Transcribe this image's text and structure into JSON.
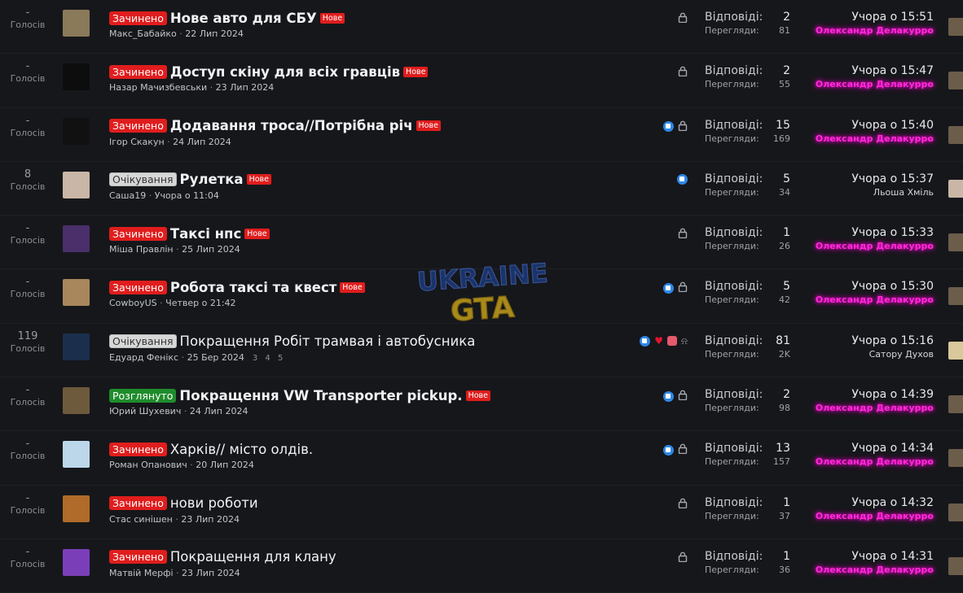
{
  "labels": {
    "votes": "Голосів",
    "replies": "Відповіді:",
    "views": "Перегляди:",
    "new": "Нове",
    "sep": " · "
  },
  "watermark": {
    "line1": "UKRAINE",
    "line2": "GTA"
  },
  "threads": [
    {
      "votes": "-",
      "prefix": "Зачинено",
      "prefix_type": "closed",
      "title": "Нове авто для СБУ",
      "bold": true,
      "is_new": true,
      "author": "Макс_Бабайко",
      "date": "22 Лип 2024",
      "icons": [
        "lock-icon"
      ],
      "replies": "2",
      "views": "81",
      "last_date": "Учора о 15:51",
      "last_user": "Олександр Делакурро",
      "last_user_style": "special",
      "avatar_color": "#8a7a5a",
      "last_av_color": "#6b5d4a"
    },
    {
      "votes": "-",
      "prefix": "Зачинено",
      "prefix_type": "closed",
      "title": "Доступ скіну для всіх гравців",
      "bold": true,
      "is_new": true,
      "author": "Назар Мачизбевськи",
      "date": "23 Лип 2024",
      "icons": [
        "lock-icon"
      ],
      "replies": "2",
      "views": "55",
      "last_date": "Учора о 15:47",
      "last_user": "Олександр Делакурро",
      "last_user_style": "special",
      "avatar_color": "#0d0d0d",
      "last_av_color": "#6b5d4a"
    },
    {
      "votes": "-",
      "prefix": "Зачинено",
      "prefix_type": "closed",
      "title": "Додавання троса//Потрібна річ",
      "bold": true,
      "is_new": true,
      "author": "Ігор Скакун",
      "date": "24 Лип 2024",
      "icons": [
        "like-icon",
        "lock-icon"
      ],
      "replies": "15",
      "views": "169",
      "last_date": "Учора о 15:40",
      "last_user": "Олександр Делакурро",
      "last_user_style": "special",
      "avatar_color": "#111111",
      "last_av_color": "#6b5d4a"
    },
    {
      "votes": "8",
      "prefix": "Очікування",
      "prefix_type": "pending",
      "title": "Рулетка",
      "bold": true,
      "is_new": true,
      "author": "Саша19",
      "date": "Учора о 11:04",
      "icons": [
        "like-icon"
      ],
      "replies": "5",
      "views": "34",
      "last_date": "Учора о 15:37",
      "last_user": "Льоша Хміль",
      "last_user_style": "plain",
      "avatar_color": "#c9b6a6",
      "last_av_color": "#c9b6a6"
    },
    {
      "votes": "-",
      "prefix": "Зачинено",
      "prefix_type": "closed",
      "title": "Таксі нпс",
      "bold": true,
      "is_new": true,
      "author": "Міша Правлін",
      "date": "25 Лип 2024",
      "icons": [
        "lock-icon"
      ],
      "replies": "1",
      "views": "26",
      "last_date": "Учора о 15:33",
      "last_user": "Олександр Делакурро",
      "last_user_style": "special",
      "avatar_color": "#4a2f6b",
      "last_av_color": "#6b5d4a"
    },
    {
      "votes": "-",
      "prefix": "Зачинено",
      "prefix_type": "closed",
      "title": "Робота таксі та квест",
      "bold": true,
      "is_new": true,
      "author": "CowboyUS",
      "date": "Четвер о 21:42",
      "icons": [
        "like-icon",
        "lock-icon"
      ],
      "replies": "5",
      "views": "42",
      "last_date": "Учора о 15:30",
      "last_user": "Олександр Делакурро",
      "last_user_style": "special",
      "avatar_color": "#a8875d",
      "last_av_color": "#6b5d4a"
    },
    {
      "votes": "119",
      "prefix": "Очікування",
      "prefix_type": "pending",
      "title": "Покращення Робіт трамвая і автобусника",
      "bold": false,
      "is_new": false,
      "author": "Едуард Фенікс",
      "date": "25 Бер 2024",
      "pages": "3 4 5",
      "icons": [
        "like-icon",
        "heart-icon",
        "wow-icon",
        "bell-icon"
      ],
      "replies": "81",
      "views": "2K",
      "last_date": "Учора о 15:16",
      "last_user": "Сатору Духов",
      "last_user_style": "plain",
      "avatar_color": "#1b2f4d",
      "last_av_color": "#d8c89a"
    },
    {
      "votes": "-",
      "prefix": "Розглянуто",
      "prefix_type": "reviewed",
      "title": "Покращення VW Transporter pickup.",
      "bold": true,
      "is_new": true,
      "author": "Юрий Шухевич",
      "date": "24 Лип 2024",
      "icons": [
        "like-icon",
        "lock-icon"
      ],
      "replies": "2",
      "views": "98",
      "last_date": "Учора о 14:39",
      "last_user": "Олександр Делакурро",
      "last_user_style": "special",
      "avatar_color": "#6d5a3c",
      "last_av_color": "#6b5d4a"
    },
    {
      "votes": "-",
      "prefix": "Зачинено",
      "prefix_type": "closed",
      "title": "Харків// місто олдів.",
      "bold": false,
      "is_new": false,
      "author": "Роман Опанович",
      "date": "20 Лип 2024",
      "icons": [
        "like-icon",
        "lock-icon"
      ],
      "replies": "13",
      "views": "157",
      "last_date": "Учора о 14:34",
      "last_user": "Олександр Делакурро",
      "last_user_style": "special",
      "avatar_color": "#bcd7ea",
      "last_av_color": "#6b5d4a"
    },
    {
      "votes": "-",
      "prefix": "Зачинено",
      "prefix_type": "closed",
      "title": "нови роботи",
      "bold": false,
      "is_new": false,
      "author": "Стас синішен",
      "date": "23 Лип 2024",
      "icons": [
        "lock-icon"
      ],
      "replies": "1",
      "views": "37",
      "last_date": "Учора о 14:32",
      "last_user": "Олександр Делакурро",
      "last_user_style": "special",
      "avatar_color": "#b06b2a",
      "last_av_color": "#6b5d4a"
    },
    {
      "votes": "-",
      "prefix": "Зачинено",
      "prefix_type": "closed",
      "title": "Покращення для клану",
      "bold": false,
      "is_new": false,
      "author": "Матвій Мерфі",
      "date": "23 Лип 2024",
      "icons": [
        "lock-icon"
      ],
      "replies": "1",
      "views": "36",
      "last_date": "Учора о 14:31",
      "last_user": "Олександр Делакурро",
      "last_user_style": "special",
      "avatar_color": "#7a3fb8",
      "last_av_color": "#6b5d4a"
    }
  ]
}
